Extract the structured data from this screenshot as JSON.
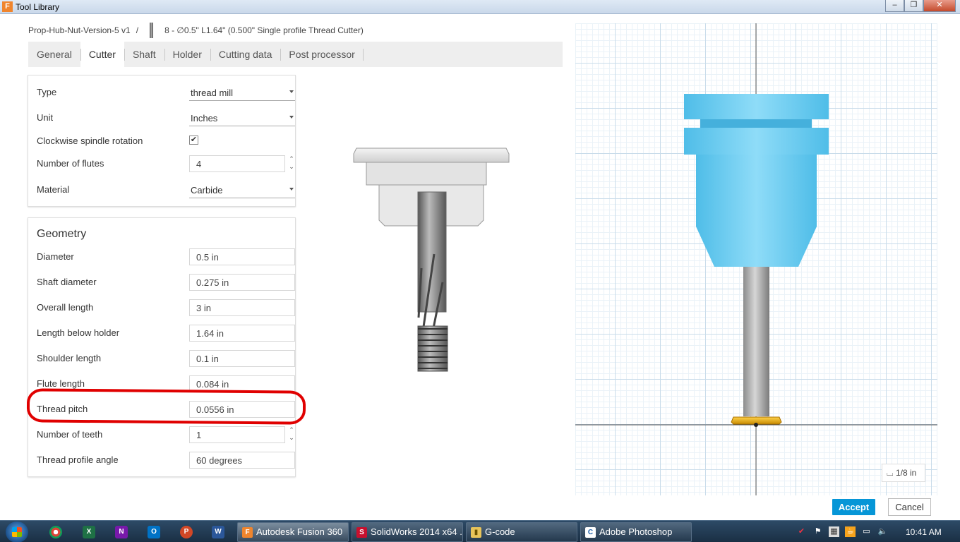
{
  "window": {
    "title": "Tool Library",
    "app_icon": "F",
    "controls": [
      "–",
      "❐",
      "✕"
    ]
  },
  "breadcrumb": {
    "document": "Prop-Hub-Nut-Version-5 v1",
    "separator": "/",
    "tool": "8 - ∅0.5\" L1.64\" (0.500\" Single profile Thread Cutter)"
  },
  "tabs": [
    "General",
    "Cutter",
    "Shaft",
    "Holder",
    "Cutting data",
    "Post processor"
  ],
  "active_tab": "Cutter",
  "cutter": {
    "type_label": "Type",
    "type_value": "thread mill",
    "unit_label": "Unit",
    "unit_value": "Inches",
    "clockwise_label": "Clockwise spindle rotation",
    "clockwise_checked": true,
    "check_mark": "✔",
    "flutes_label": "Number of flutes",
    "flutes_value": "4",
    "material_label": "Material",
    "material_value": "Carbide"
  },
  "geometry": {
    "title": "Geometry",
    "diameter_label": "Diameter",
    "diameter_value": "0.5 in",
    "shaft_diameter_label": "Shaft diameter",
    "shaft_diameter_value": "0.275 in",
    "overall_length_label": "Overall length",
    "overall_length_value": "3 in",
    "length_below_holder_label": "Length below holder",
    "length_below_holder_value": "1.64 in",
    "shoulder_length_label": "Shoulder length",
    "shoulder_length_value": "0.1 in",
    "flute_length_label": "Flute length",
    "flute_length_value": "0.084 in",
    "thread_pitch_label": "Thread pitch",
    "thread_pitch_value": "0.0556 in",
    "teeth_label": "Number of teeth",
    "teeth_value": "1",
    "profile_angle_label": "Thread profile angle",
    "profile_angle_value": "60 degrees"
  },
  "annotation": {
    "color": "#e00000",
    "highlights": "Thread pitch"
  },
  "viewport": {
    "scale_label": "1/8 in",
    "holder_color": "#5bc8f0",
    "insert_color": "#f0a800"
  },
  "buttons": {
    "accept": "Accept",
    "cancel": "Cancel"
  },
  "taskbar": {
    "tasks": [
      "Autodesk Fusion 360",
      "SolidWorks 2014 x64 ...",
      "G-code",
      "Adobe Photoshop"
    ],
    "clock": "10:41 AM"
  }
}
